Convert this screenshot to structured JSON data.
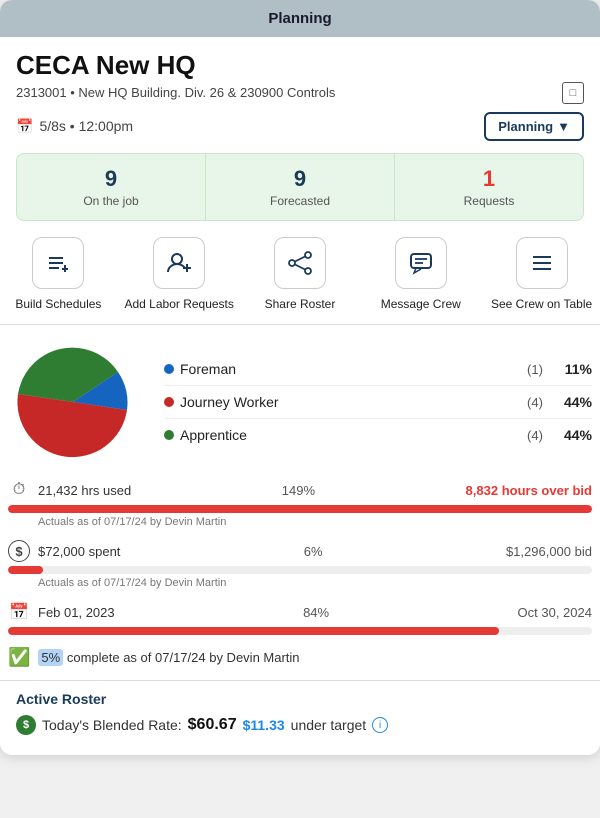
{
  "header": {
    "title": "Planning"
  },
  "project": {
    "title": "CECA New HQ",
    "subtitle": "2313001 • New HQ Building. Div. 26 & 230900 Controls",
    "date": "5/8s • 12:00pm",
    "status_btn": "Planning"
  },
  "stats": {
    "on_the_job": {
      "value": "9",
      "label": "On the job"
    },
    "forecasted": {
      "value": "9",
      "label": "Forecasted"
    },
    "requests": {
      "value": "1",
      "label": "Requests"
    }
  },
  "actions": [
    {
      "id": "build-schedules",
      "icon": "≡+",
      "label": "Build Schedules"
    },
    {
      "id": "add-labor-requests",
      "icon": "👤+",
      "label": "Add Labor Requests"
    },
    {
      "id": "share-roster",
      "icon": "◁▷",
      "label": "Share Roster"
    },
    {
      "id": "message-crew",
      "icon": "💬",
      "label": "Message Crew"
    },
    {
      "id": "see-crew-table",
      "icon": "≡",
      "label": "See Crew on Table"
    }
  ],
  "chart": {
    "segments": [
      {
        "role": "Foreman",
        "color": "#1565c0",
        "count": "(1)",
        "pct": "11%",
        "slice": 11
      },
      {
        "role": "Journey Worker",
        "color": "#c62828",
        "count": "(4)",
        "pct": "44%",
        "slice": 44
      },
      {
        "role": "Apprentice",
        "color": "#2e7d32",
        "count": "(4)",
        "pct": "44%",
        "slice": 44
      }
    ]
  },
  "metrics": [
    {
      "id": "hours",
      "icon": "⏱",
      "main": "21,432 hrs used",
      "mid": "149%",
      "right": "8,832 hours over bid",
      "right_color": "red",
      "progress": 100,
      "bar_color": "#e53935",
      "sub": "Actuals as of 07/17/24 by Devin Martin"
    },
    {
      "id": "spend",
      "icon": "$",
      "main": "$72,000 spent",
      "mid": "6%",
      "right": "$1,296,000 bid",
      "right_color": "gray",
      "progress": 6,
      "bar_color": "#e53935",
      "sub": "Actuals as of 07/17/24 by Devin Martin"
    },
    {
      "id": "dates",
      "icon": "📅",
      "main": "Feb 01, 2023",
      "mid": "84%",
      "right": "Oct 30, 2024",
      "right_color": "gray",
      "progress": 84,
      "bar_color": "#e53935",
      "sub": ""
    }
  ],
  "completion": {
    "pct": "5%",
    "text": "complete as of 07/17/24 by Devin Martin"
  },
  "active_roster": {
    "title": "Active Roster",
    "blended_label": "Today's Blended Rate:",
    "rate": "$60.67",
    "under_target": "$11.33",
    "under_label": "under target"
  }
}
